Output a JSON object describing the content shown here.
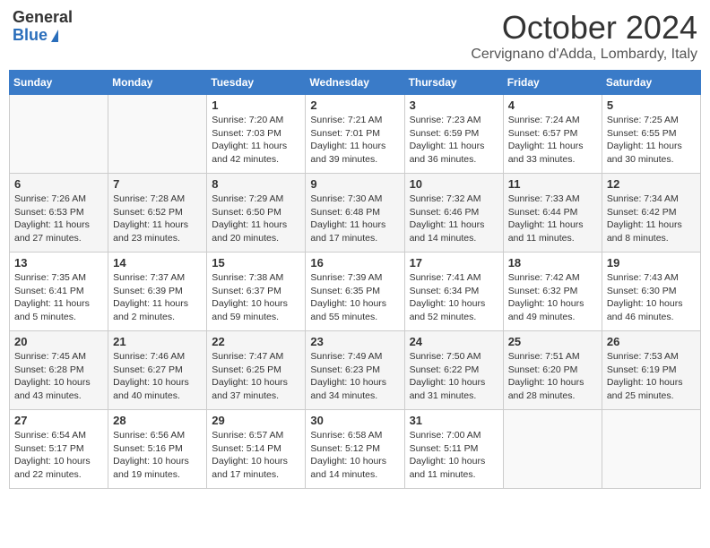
{
  "header": {
    "logo_general": "General",
    "logo_blue": "Blue",
    "month": "October 2024",
    "location": "Cervignano d'Adda, Lombardy, Italy"
  },
  "weekdays": [
    "Sunday",
    "Monday",
    "Tuesday",
    "Wednesday",
    "Thursday",
    "Friday",
    "Saturday"
  ],
  "weeks": [
    [
      {
        "day": "",
        "info": ""
      },
      {
        "day": "",
        "info": ""
      },
      {
        "day": "1",
        "info": "Sunrise: 7:20 AM\nSunset: 7:03 PM\nDaylight: 11 hours and 42 minutes."
      },
      {
        "day": "2",
        "info": "Sunrise: 7:21 AM\nSunset: 7:01 PM\nDaylight: 11 hours and 39 minutes."
      },
      {
        "day": "3",
        "info": "Sunrise: 7:23 AM\nSunset: 6:59 PM\nDaylight: 11 hours and 36 minutes."
      },
      {
        "day": "4",
        "info": "Sunrise: 7:24 AM\nSunset: 6:57 PM\nDaylight: 11 hours and 33 minutes."
      },
      {
        "day": "5",
        "info": "Sunrise: 7:25 AM\nSunset: 6:55 PM\nDaylight: 11 hours and 30 minutes."
      }
    ],
    [
      {
        "day": "6",
        "info": "Sunrise: 7:26 AM\nSunset: 6:53 PM\nDaylight: 11 hours and 27 minutes."
      },
      {
        "day": "7",
        "info": "Sunrise: 7:28 AM\nSunset: 6:52 PM\nDaylight: 11 hours and 23 minutes."
      },
      {
        "day": "8",
        "info": "Sunrise: 7:29 AM\nSunset: 6:50 PM\nDaylight: 11 hours and 20 minutes."
      },
      {
        "day": "9",
        "info": "Sunrise: 7:30 AM\nSunset: 6:48 PM\nDaylight: 11 hours and 17 minutes."
      },
      {
        "day": "10",
        "info": "Sunrise: 7:32 AM\nSunset: 6:46 PM\nDaylight: 11 hours and 14 minutes."
      },
      {
        "day": "11",
        "info": "Sunrise: 7:33 AM\nSunset: 6:44 PM\nDaylight: 11 hours and 11 minutes."
      },
      {
        "day": "12",
        "info": "Sunrise: 7:34 AM\nSunset: 6:42 PM\nDaylight: 11 hours and 8 minutes."
      }
    ],
    [
      {
        "day": "13",
        "info": "Sunrise: 7:35 AM\nSunset: 6:41 PM\nDaylight: 11 hours and 5 minutes."
      },
      {
        "day": "14",
        "info": "Sunrise: 7:37 AM\nSunset: 6:39 PM\nDaylight: 11 hours and 2 minutes."
      },
      {
        "day": "15",
        "info": "Sunrise: 7:38 AM\nSunset: 6:37 PM\nDaylight: 10 hours and 59 minutes."
      },
      {
        "day": "16",
        "info": "Sunrise: 7:39 AM\nSunset: 6:35 PM\nDaylight: 10 hours and 55 minutes."
      },
      {
        "day": "17",
        "info": "Sunrise: 7:41 AM\nSunset: 6:34 PM\nDaylight: 10 hours and 52 minutes."
      },
      {
        "day": "18",
        "info": "Sunrise: 7:42 AM\nSunset: 6:32 PM\nDaylight: 10 hours and 49 minutes."
      },
      {
        "day": "19",
        "info": "Sunrise: 7:43 AM\nSunset: 6:30 PM\nDaylight: 10 hours and 46 minutes."
      }
    ],
    [
      {
        "day": "20",
        "info": "Sunrise: 7:45 AM\nSunset: 6:28 PM\nDaylight: 10 hours and 43 minutes."
      },
      {
        "day": "21",
        "info": "Sunrise: 7:46 AM\nSunset: 6:27 PM\nDaylight: 10 hours and 40 minutes."
      },
      {
        "day": "22",
        "info": "Sunrise: 7:47 AM\nSunset: 6:25 PM\nDaylight: 10 hours and 37 minutes."
      },
      {
        "day": "23",
        "info": "Sunrise: 7:49 AM\nSunset: 6:23 PM\nDaylight: 10 hours and 34 minutes."
      },
      {
        "day": "24",
        "info": "Sunrise: 7:50 AM\nSunset: 6:22 PM\nDaylight: 10 hours and 31 minutes."
      },
      {
        "day": "25",
        "info": "Sunrise: 7:51 AM\nSunset: 6:20 PM\nDaylight: 10 hours and 28 minutes."
      },
      {
        "day": "26",
        "info": "Sunrise: 7:53 AM\nSunset: 6:19 PM\nDaylight: 10 hours and 25 minutes."
      }
    ],
    [
      {
        "day": "27",
        "info": "Sunrise: 6:54 AM\nSunset: 5:17 PM\nDaylight: 10 hours and 22 minutes."
      },
      {
        "day": "28",
        "info": "Sunrise: 6:56 AM\nSunset: 5:16 PM\nDaylight: 10 hours and 19 minutes."
      },
      {
        "day": "29",
        "info": "Sunrise: 6:57 AM\nSunset: 5:14 PM\nDaylight: 10 hours and 17 minutes."
      },
      {
        "day": "30",
        "info": "Sunrise: 6:58 AM\nSunset: 5:12 PM\nDaylight: 10 hours and 14 minutes."
      },
      {
        "day": "31",
        "info": "Sunrise: 7:00 AM\nSunset: 5:11 PM\nDaylight: 10 hours and 11 minutes."
      },
      {
        "day": "",
        "info": ""
      },
      {
        "day": "",
        "info": ""
      }
    ]
  ]
}
